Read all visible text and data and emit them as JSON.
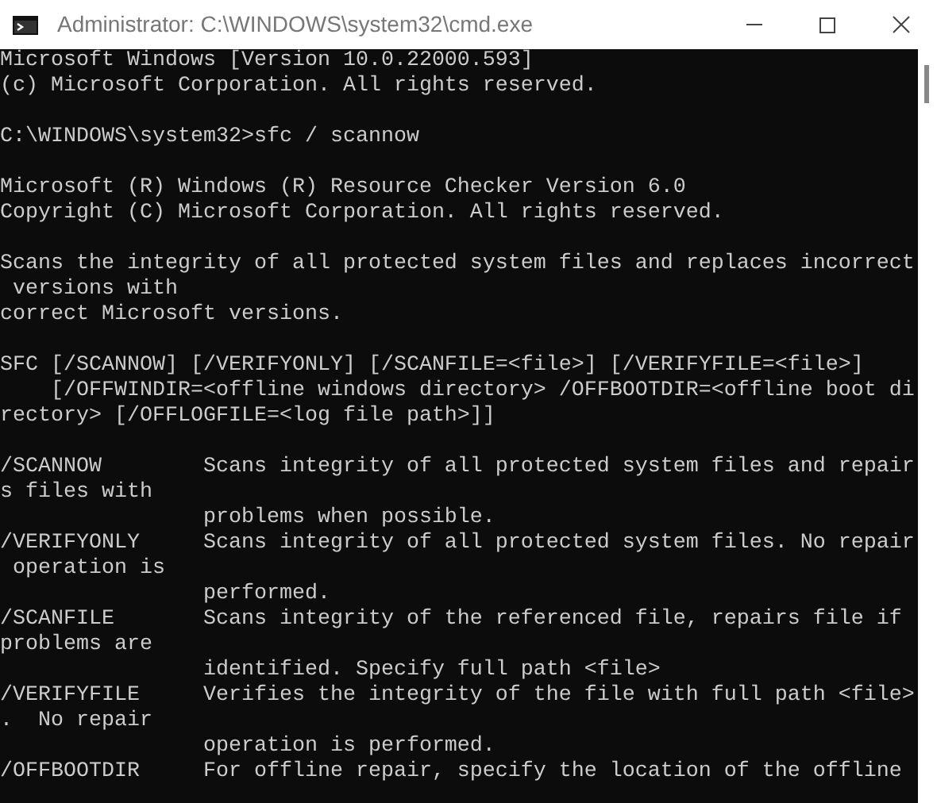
{
  "window": {
    "title": "Administrator: C:\\WINDOWS\\system32\\cmd.exe"
  },
  "console": {
    "blocks": [
      [
        "Microsoft Windows [Version 10.0.22000.593]",
        "(c) Microsoft Corporation. All rights reserved."
      ],
      [
        "C:\\WINDOWS\\system32>sfc / scannow"
      ],
      [
        "Microsoft (R) Windows (R) Resource Checker Version 6.0",
        "Copyright (C) Microsoft Corporation. All rights reserved."
      ],
      [
        "Scans the integrity of all protected system files and replaces incorrect",
        " versions with",
        "correct Microsoft versions."
      ],
      [
        "SFC [/SCANNOW] [/VERIFYONLY] [/SCANFILE=<file>] [/VERIFYFILE=<file>]",
        "    [/OFFWINDIR=<offline windows directory> /OFFBOOTDIR=<offline boot di",
        "rectory> [/OFFLOGFILE=<log file path>]]"
      ],
      [
        "/SCANNOW        Scans integrity of all protected system files and repair",
        "s files with",
        "                problems when possible.",
        "/VERIFYONLY     Scans integrity of all protected system files. No repair",
        " operation is",
        "                performed.",
        "/SCANFILE       Scans integrity of the referenced file, repairs file if",
        "problems are",
        "                identified. Specify full path <file>",
        "/VERIFYFILE     Verifies the integrity of the file with full path <file>",
        ".  No repair",
        "                operation is performed.",
        "/OFFBOOTDIR     For offline repair, specify the location of the offline"
      ]
    ]
  }
}
